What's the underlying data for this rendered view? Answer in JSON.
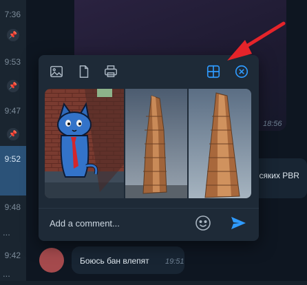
{
  "left_list": {
    "times": [
      "7:36",
      "9:53",
      "9:47",
      "9:52",
      "9:48",
      "9:42"
    ],
    "dots": "..."
  },
  "chat": {
    "media_time": "18:56",
    "side_message_text": "ясяких PBR",
    "bottom_message": {
      "text": "Боюсь бан влепят",
      "time": "19:51"
    }
  },
  "popup": {
    "toolbar": {
      "photo_icon": "image-icon",
      "file_icon": "file-icon",
      "print_icon": "printer-icon",
      "grid_icon": "grid-icon",
      "close_icon": "close-circle-icon"
    },
    "comment_placeholder": "Add a comment...",
    "emoji_icon": "emoji-icon",
    "send_icon": "send-icon"
  },
  "colors": {
    "accent": "#2f9bff",
    "annotation": "#e5242a",
    "active_row": "#2b5278"
  }
}
